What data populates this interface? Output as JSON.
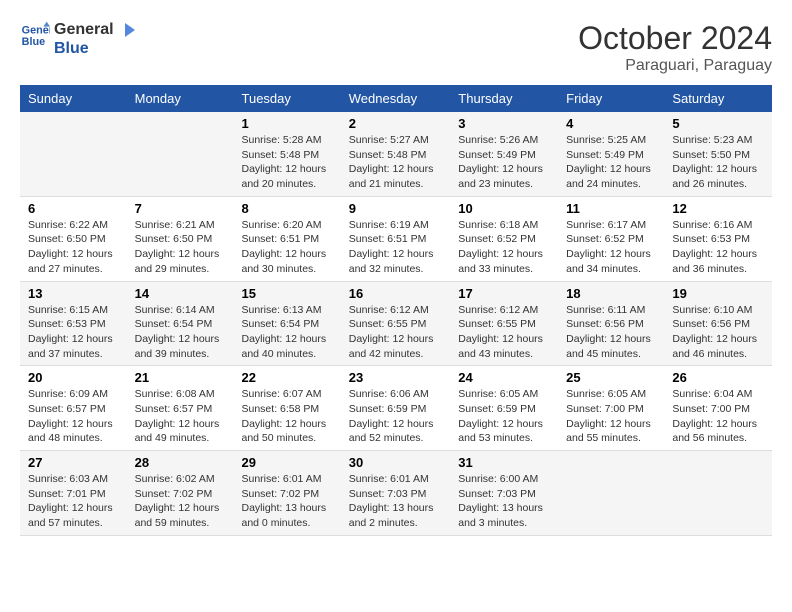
{
  "header": {
    "logo_line1": "General",
    "logo_line2": "Blue",
    "title": "October 2024",
    "subtitle": "Paraguari, Paraguay"
  },
  "weekdays": [
    "Sunday",
    "Monday",
    "Tuesday",
    "Wednesday",
    "Thursday",
    "Friday",
    "Saturday"
  ],
  "weeks": [
    [
      {
        "day": "",
        "info": ""
      },
      {
        "day": "",
        "info": ""
      },
      {
        "day": "1",
        "info": "Sunrise: 5:28 AM\nSunset: 5:48 PM\nDaylight: 12 hours\nand 20 minutes."
      },
      {
        "day": "2",
        "info": "Sunrise: 5:27 AM\nSunset: 5:48 PM\nDaylight: 12 hours\nand 21 minutes."
      },
      {
        "day": "3",
        "info": "Sunrise: 5:26 AM\nSunset: 5:49 PM\nDaylight: 12 hours\nand 23 minutes."
      },
      {
        "day": "4",
        "info": "Sunrise: 5:25 AM\nSunset: 5:49 PM\nDaylight: 12 hours\nand 24 minutes."
      },
      {
        "day": "5",
        "info": "Sunrise: 5:23 AM\nSunset: 5:50 PM\nDaylight: 12 hours\nand 26 minutes."
      }
    ],
    [
      {
        "day": "6",
        "info": "Sunrise: 6:22 AM\nSunset: 6:50 PM\nDaylight: 12 hours\nand 27 minutes."
      },
      {
        "day": "7",
        "info": "Sunrise: 6:21 AM\nSunset: 6:50 PM\nDaylight: 12 hours\nand 29 minutes."
      },
      {
        "day": "8",
        "info": "Sunrise: 6:20 AM\nSunset: 6:51 PM\nDaylight: 12 hours\nand 30 minutes."
      },
      {
        "day": "9",
        "info": "Sunrise: 6:19 AM\nSunset: 6:51 PM\nDaylight: 12 hours\nand 32 minutes."
      },
      {
        "day": "10",
        "info": "Sunrise: 6:18 AM\nSunset: 6:52 PM\nDaylight: 12 hours\nand 33 minutes."
      },
      {
        "day": "11",
        "info": "Sunrise: 6:17 AM\nSunset: 6:52 PM\nDaylight: 12 hours\nand 34 minutes."
      },
      {
        "day": "12",
        "info": "Sunrise: 6:16 AM\nSunset: 6:53 PM\nDaylight: 12 hours\nand 36 minutes."
      }
    ],
    [
      {
        "day": "13",
        "info": "Sunrise: 6:15 AM\nSunset: 6:53 PM\nDaylight: 12 hours\nand 37 minutes."
      },
      {
        "day": "14",
        "info": "Sunrise: 6:14 AM\nSunset: 6:54 PM\nDaylight: 12 hours\nand 39 minutes."
      },
      {
        "day": "15",
        "info": "Sunrise: 6:13 AM\nSunset: 6:54 PM\nDaylight: 12 hours\nand 40 minutes."
      },
      {
        "day": "16",
        "info": "Sunrise: 6:12 AM\nSunset: 6:55 PM\nDaylight: 12 hours\nand 42 minutes."
      },
      {
        "day": "17",
        "info": "Sunrise: 6:12 AM\nSunset: 6:55 PM\nDaylight: 12 hours\nand 43 minutes."
      },
      {
        "day": "18",
        "info": "Sunrise: 6:11 AM\nSunset: 6:56 PM\nDaylight: 12 hours\nand 45 minutes."
      },
      {
        "day": "19",
        "info": "Sunrise: 6:10 AM\nSunset: 6:56 PM\nDaylight: 12 hours\nand 46 minutes."
      }
    ],
    [
      {
        "day": "20",
        "info": "Sunrise: 6:09 AM\nSunset: 6:57 PM\nDaylight: 12 hours\nand 48 minutes."
      },
      {
        "day": "21",
        "info": "Sunrise: 6:08 AM\nSunset: 6:57 PM\nDaylight: 12 hours\nand 49 minutes."
      },
      {
        "day": "22",
        "info": "Sunrise: 6:07 AM\nSunset: 6:58 PM\nDaylight: 12 hours\nand 50 minutes."
      },
      {
        "day": "23",
        "info": "Sunrise: 6:06 AM\nSunset: 6:59 PM\nDaylight: 12 hours\nand 52 minutes."
      },
      {
        "day": "24",
        "info": "Sunrise: 6:05 AM\nSunset: 6:59 PM\nDaylight: 12 hours\nand 53 minutes."
      },
      {
        "day": "25",
        "info": "Sunrise: 6:05 AM\nSunset: 7:00 PM\nDaylight: 12 hours\nand 55 minutes."
      },
      {
        "day": "26",
        "info": "Sunrise: 6:04 AM\nSunset: 7:00 PM\nDaylight: 12 hours\nand 56 minutes."
      }
    ],
    [
      {
        "day": "27",
        "info": "Sunrise: 6:03 AM\nSunset: 7:01 PM\nDaylight: 12 hours\nand 57 minutes."
      },
      {
        "day": "28",
        "info": "Sunrise: 6:02 AM\nSunset: 7:02 PM\nDaylight: 12 hours\nand 59 minutes."
      },
      {
        "day": "29",
        "info": "Sunrise: 6:01 AM\nSunset: 7:02 PM\nDaylight: 13 hours\nand 0 minutes."
      },
      {
        "day": "30",
        "info": "Sunrise: 6:01 AM\nSunset: 7:03 PM\nDaylight: 13 hours\nand 2 minutes."
      },
      {
        "day": "31",
        "info": "Sunrise: 6:00 AM\nSunset: 7:03 PM\nDaylight: 13 hours\nand 3 minutes."
      },
      {
        "day": "",
        "info": ""
      },
      {
        "day": "",
        "info": ""
      }
    ]
  ]
}
